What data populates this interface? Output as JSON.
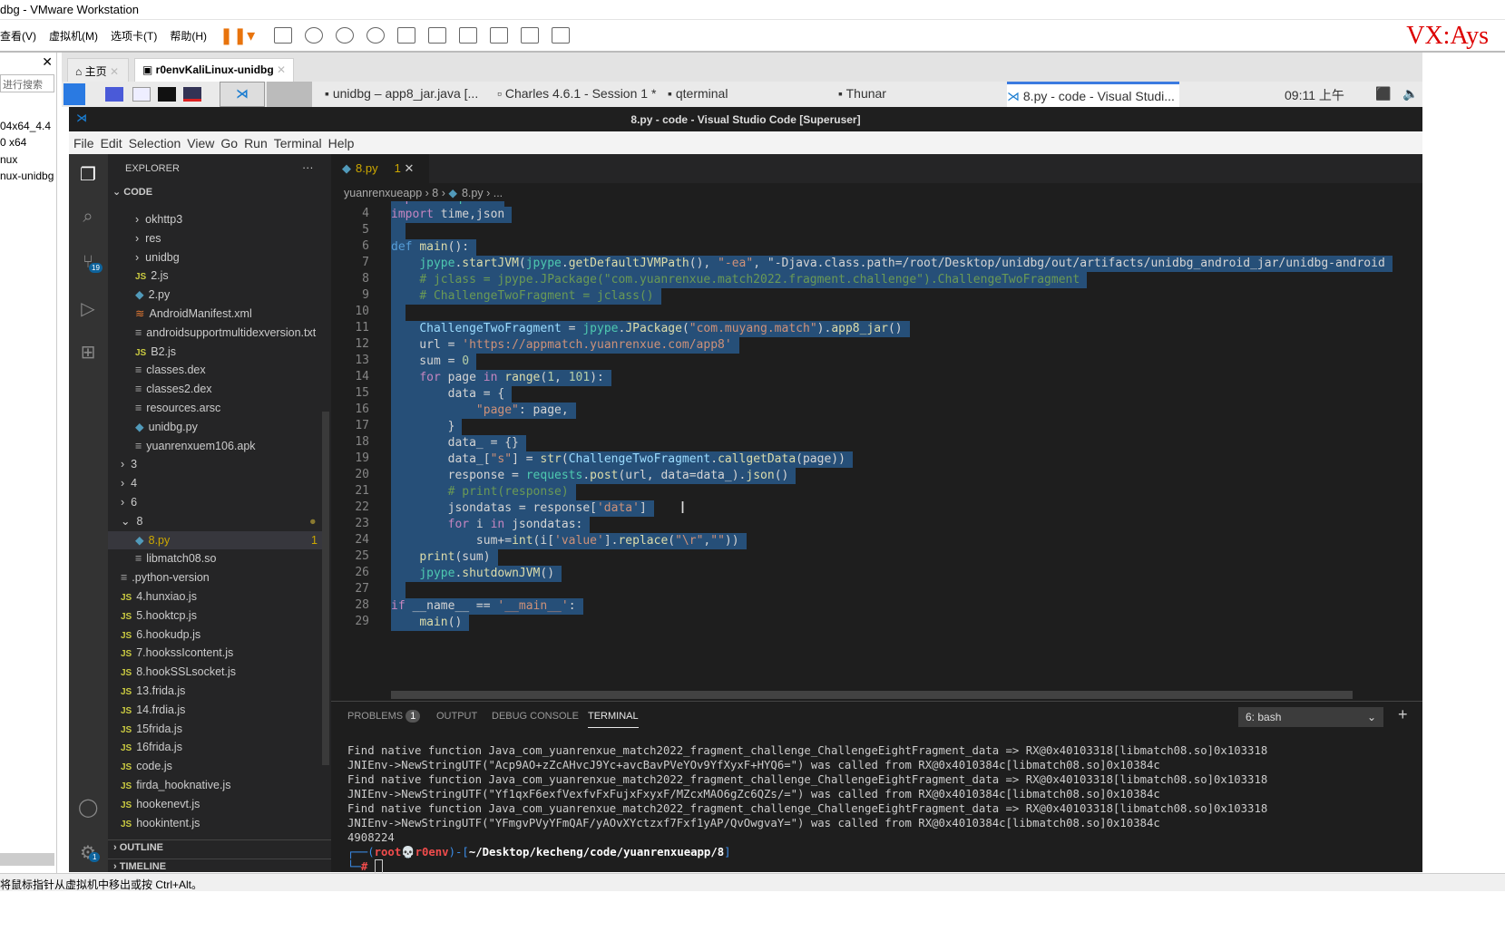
{
  "vmware": {
    "title": "dbg - VMware Workstation",
    "menu": [
      "查看(V)",
      "虚拟机(M)",
      "选项卡(T)",
      "帮助(H)"
    ],
    "watermark": "VX:Ays",
    "library": {
      "search": "进行搜索",
      "items": [
        "04x64_4.4",
        "0 x64",
        "nux",
        "nux-unidbg"
      ]
    },
    "tabs": [
      "主页",
      "r0envKaliLinux-unidbg"
    ],
    "status": "将鼠标指针从虚拟机中移出或按 Ctrl+Alt。"
  },
  "kali": {
    "tasks": [
      "unidbg – app8_jar.java [...",
      "Charles 4.6.1 - Session 1 *",
      "qterminal",
      "Thunar",
      "8.py - code - Visual Studi..."
    ],
    "clock": "09:11 上午"
  },
  "vscode": {
    "title": "8.py - code - Visual Studio Code [Superuser]",
    "menu": [
      "File",
      "Edit",
      "Selection",
      "View",
      "Go",
      "Run",
      "Terminal",
      "Help"
    ],
    "scm_badge": "19",
    "settings_badge": "1",
    "explorer": {
      "title": "EXPLORER",
      "more": "···",
      "root": "CODE",
      "outline": "OUTLINE",
      "timeline": "TIMELINE",
      "items": [
        {
          "name": "okhttp3",
          "type": "folder",
          "level": 2
        },
        {
          "name": "res",
          "type": "folder",
          "level": 2
        },
        {
          "name": "unidbg",
          "type": "folder",
          "level": 2
        },
        {
          "name": "2.js",
          "type": "js",
          "level": 2
        },
        {
          "name": "2.py",
          "type": "py",
          "level": 2
        },
        {
          "name": "AndroidManifest.xml",
          "type": "xml",
          "level": 2
        },
        {
          "name": "androidsupportmultidexversion.txt",
          "type": "txt",
          "level": 2
        },
        {
          "name": "B2.js",
          "type": "js",
          "level": 2
        },
        {
          "name": "classes.dex",
          "type": "txt",
          "level": 2
        },
        {
          "name": "classes2.dex",
          "type": "txt",
          "level": 2
        },
        {
          "name": "resources.arsc",
          "type": "txt",
          "level": 2
        },
        {
          "name": "unidbg.py",
          "type": "py",
          "level": 2
        },
        {
          "name": "yuanrenxuem106.apk",
          "type": "txt",
          "level": 2
        },
        {
          "name": "3",
          "type": "folder",
          "level": 1
        },
        {
          "name": "4",
          "type": "folder",
          "level": 1
        },
        {
          "name": "6",
          "type": "folder",
          "level": 1
        },
        {
          "name": "8",
          "type": "folder-open",
          "level": 1
        },
        {
          "name": "8.py",
          "type": "py",
          "level": 2,
          "active": true,
          "badge": "1"
        },
        {
          "name": "libmatch08.so",
          "type": "txt",
          "level": 2
        },
        {
          "name": ".python-version",
          "type": "txt",
          "level": 1
        },
        {
          "name": "4.hunxiao.js",
          "type": "js",
          "level": 1
        },
        {
          "name": "5.hooktcp.js",
          "type": "js",
          "level": 1
        },
        {
          "name": "6.hookudp.js",
          "type": "js",
          "level": 1
        },
        {
          "name": "7.hookssIcontent.js",
          "type": "js",
          "level": 1
        },
        {
          "name": "8.hookSSLsocket.js",
          "type": "js",
          "level": 1
        },
        {
          "name": "13.frida.js",
          "type": "js",
          "level": 1
        },
        {
          "name": "14.frdia.js",
          "type": "js",
          "level": 1
        },
        {
          "name": "15frida.js",
          "type": "js",
          "level": 1
        },
        {
          "name": "16frida.js",
          "type": "js",
          "level": 1
        },
        {
          "name": "code.js",
          "type": "js",
          "level": 1
        },
        {
          "name": "firda_hooknative.js",
          "type": "js",
          "level": 1
        },
        {
          "name": "hookenevt.js",
          "type": "js",
          "level": 1
        },
        {
          "name": "hookintent.js",
          "type": "js",
          "level": 1
        }
      ]
    },
    "tab": {
      "label": "8.py",
      "problems": "1"
    },
    "breadcrumb": [
      "yuanrenxueapp",
      "8",
      "8.py",
      "..."
    ],
    "code": {
      "start": 3,
      "lines": [
        "import requests",
        "import time,json",
        "",
        "def main():",
        "    jpype.startJVM(jpype.getDefaultJVMPath(), \"-ea\", \"-Djava.class.path=/root/Desktop/unidbg/out/artifacts/unidbg_android_jar/unidbg-android",
        "    # jclass = jpype.JPackage(\"com.yuanrenxue.match2022.fragment.challenge\").ChallengeTwoFragment",
        "    # ChallengeTwoFragment = jclass()",
        "",
        "    ChallengeTwoFragment = jpype.JPackage(\"com.muyang.match\").app8_jar()",
        "    url = 'https://appmatch.yuanrenxue.com/app8'",
        "    sum = 0",
        "    for page in range(1, 101):",
        "        data = {",
        "            \"page\": page,",
        "        }",
        "        data_ = {}",
        "        data_[\"s\"] = str(ChallengeTwoFragment.callgetData(page))",
        "        response = requests.post(url, data=data_).json()",
        "        # print(response)",
        "        jsondatas = response['data']",
        "        for i in jsondatas:",
        "            sum+=int(i['value'].replace(\"\\r\",\"\"))",
        "    print(sum)",
        "    jpype.shutdownJVM()",
        "",
        "if __name__ == '__main__':",
        "    main()"
      ]
    },
    "panel": {
      "tabs": [
        "PROBLEMS",
        "OUTPUT",
        "DEBUG CONSOLE",
        "TERMINAL"
      ],
      "problems_count": "1",
      "terminal_select": "6: bash",
      "add": "+",
      "terminal": [
        "Find native function Java_com_yuanrenxue_match2022_fragment_challenge_ChallengeEightFragment_data => RX@0x40103318[libmatch08.so]0x103318",
        "JNIEnv->NewStringUTF(\"Acp9AO+zZcAHvcJ9Yc+avcBavPVeYOv9YfXyxF+HYQ6=\") was called from RX@0x4010384c[libmatch08.so]0x10384c",
        "Find native function Java_com_yuanrenxue_match2022_fragment_challenge_ChallengeEightFragment_data => RX@0x40103318[libmatch08.so]0x103318",
        "JNIEnv->NewStringUTF(\"Yf1qxF6exfVexfvFxFujxFxyxF/MZcxMAO6gZc6QZs/=\") was called from RX@0x4010384c[libmatch08.so]0x10384c",
        "Find native function Java_com_yuanrenxue_match2022_fragment_challenge_ChallengeEightFragment_data => RX@0x40103318[libmatch08.so]0x103318",
        "JNIEnv->NewStringUTF(\"YFmgvPVyYFmQAF/yAOvXYctzxf7Fxf1yAP/QvOwgvaY=\") was called from RX@0x4010384c[libmatch08.so]0x10384c",
        "4908224"
      ],
      "prompt": {
        "user": "root",
        "host": "r0env",
        "path": "~/Desktop/kecheng/code/yuanrenxueapp/8"
      }
    }
  }
}
